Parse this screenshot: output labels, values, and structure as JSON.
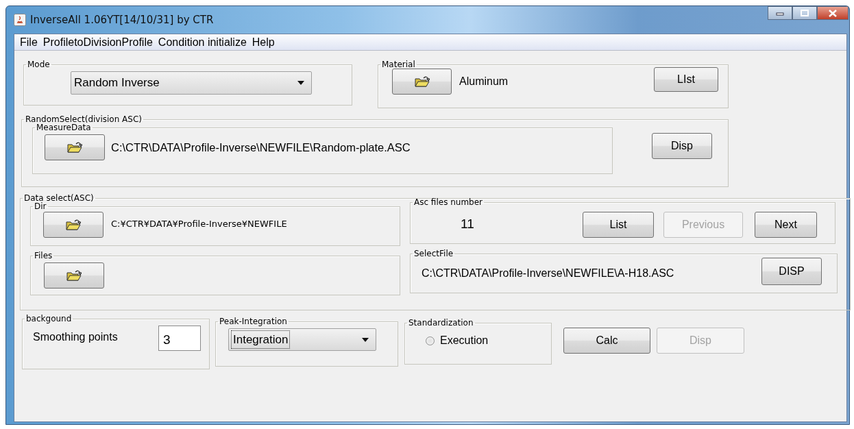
{
  "window": {
    "title": "InverseAll 1.06YT[14/10/31] by CTR"
  },
  "menu": [
    "File",
    "ProfiletoDivisionProfile",
    "Condition initialize",
    "Help"
  ],
  "mode": {
    "label": "Mode",
    "value": "Random Inverse"
  },
  "material": {
    "label": "Material",
    "value": "Aluminum",
    "button": "LIst"
  },
  "random_select": {
    "label": "RandomSelect(division ASC)",
    "measure_data": {
      "label": "MeasureData",
      "path": "C:\\CTR\\DATA\\Profile-Inverse\\NEWFILE\\Random-plate.ASC"
    },
    "button": "Disp"
  },
  "data_select": {
    "label": "Data select(ASC)",
    "dir": {
      "label": "Dir",
      "path": "C:¥CTR¥DATA¥Profile-Inverse¥NEWFILE"
    },
    "files": {
      "label": "Files"
    },
    "asc_files_number": {
      "label": "Asc files number",
      "count": "11",
      "buttons": [
        {
          "label": "List",
          "disabled": false
        },
        {
          "label": "Previous",
          "disabled": true
        },
        {
          "label": "Next",
          "disabled": false
        }
      ]
    },
    "select_file": {
      "label": "SelectFile",
      "path": "C:\\CTR\\DATA\\Profile-Inverse\\NEWFILE\\A-H18.ASC",
      "button": "DISP"
    }
  },
  "background": {
    "label": "backgound",
    "smoothing_label": "Smoothing points",
    "value": "3"
  },
  "peak_integration": {
    "label": "Peak-Integration",
    "value": "Integration"
  },
  "standardization": {
    "label": "Standardization",
    "option": {
      "label": "Execution",
      "selected": false
    }
  },
  "buttons": [
    {
      "label": "Calc",
      "disabled": false
    },
    {
      "label": "Disp",
      "disabled": true
    }
  ]
}
